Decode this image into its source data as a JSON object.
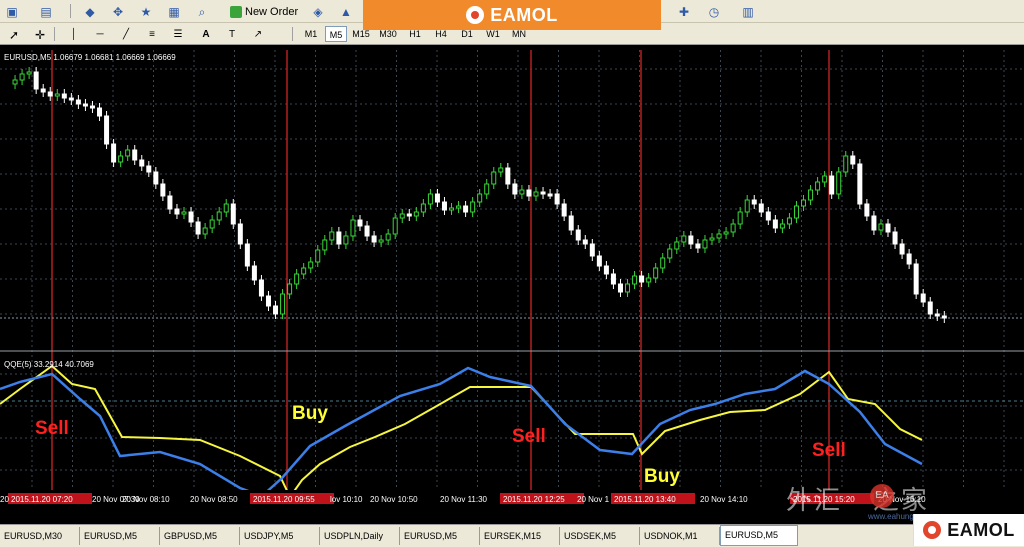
{
  "toolbar": {
    "new_order_label": "New Order",
    "timeframes": [
      "M1",
      "M5",
      "M15",
      "M30",
      "H1",
      "H4",
      "D1",
      "W1",
      "MN"
    ],
    "active_timeframe": "M5"
  },
  "brand": {
    "logo_text": "EAMOL",
    "accent": "#f08a2a",
    "logo_red": "#e1452b"
  },
  "price_panel": {
    "header": "EURUSD,M5 1.06679 1.06681 1.06669 1.06669",
    "up_color": "#39d739",
    "down_color": "#ffffff"
  },
  "indicator_panel": {
    "header": "QQE(5) 33.2914 40.7069",
    "fast_color": "#3c7fe8",
    "slow_color": "#f6f640",
    "signals": [
      {
        "text": "Sell",
        "color": "#ff2020"
      },
      {
        "text": "Buy",
        "color": "#ffff33"
      },
      {
        "text": "Sell",
        "color": "#ff2020"
      },
      {
        "text": "Buy",
        "color": "#ffff33"
      },
      {
        "text": "Sell",
        "color": "#ff2020"
      }
    ]
  },
  "time_axis": {
    "labels": [
      "20",
      "20 Nov 07:30",
      "20 Nov 08:10",
      "20 Nov 08:50",
      "lov 10:10",
      "20 Nov 10:50",
      "20 Nov 11:30",
      "20 Nov 1",
      "20 Nov 14:10",
      "20 Nov 16:10"
    ],
    "highlighted": [
      "2015.11.20 07:20",
      "2015.11.20 09:55",
      "2015.11.20 12:25",
      "2015.11.20 13:40",
      "2015.11.20 15:20"
    ]
  },
  "symbol_tabs": [
    "EURUSD,M30",
    "EURUSD,M5",
    "GBPUSD,M5",
    "USDJPY,M5",
    "USDPLN,Daily",
    "EURUSD,M5",
    "EURSEK,M15",
    "USDSEK,M5",
    "USDNOK,M1",
    "EURUSD,M5"
  ],
  "active_tab_index": 9,
  "watermark": {
    "text": "外汇",
    "text2": "之家",
    "badge": "EA",
    "url": "www.eahung.com"
  }
}
